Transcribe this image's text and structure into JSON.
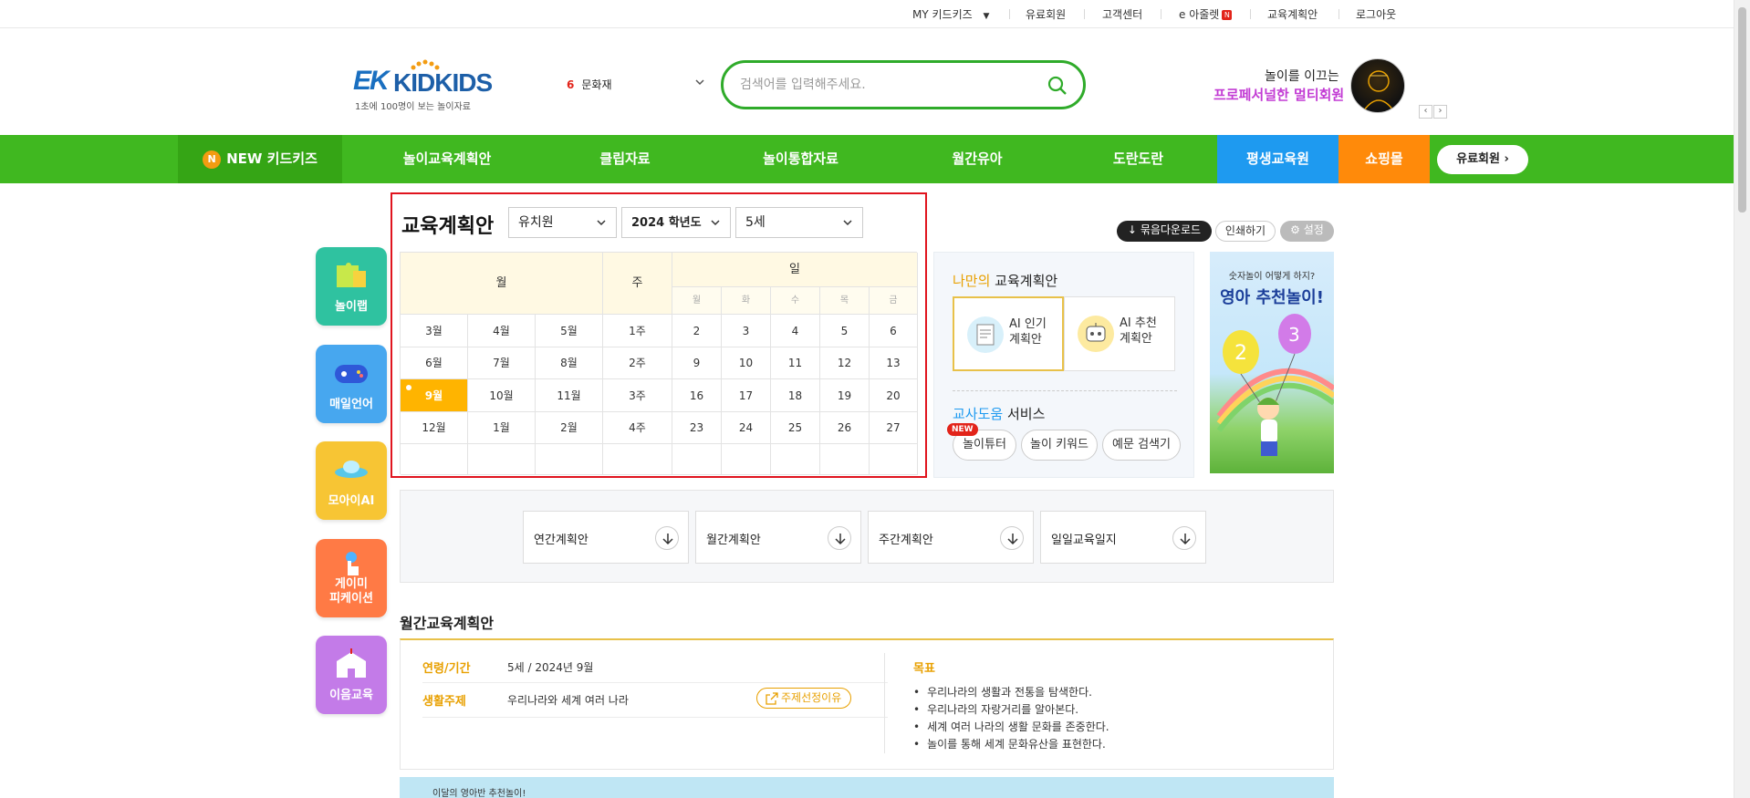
{
  "util": {
    "my_kidkids": "MY 키드키즈",
    "paid_member": "유료회원",
    "customer_center": "고객센터",
    "e_album": "e 아줄렛",
    "e_album_badge": "N",
    "edu_plan": "교육계획안",
    "logout": "로그아웃"
  },
  "logo": {
    "ek": "EK",
    "kids": "KIDKIDS",
    "tagline": "1초에 100명이 보는 놀이자료"
  },
  "rank": {
    "num": "6",
    "label": "문화재"
  },
  "search": {
    "placeholder": "검색어를 입력해주세요."
  },
  "promo": {
    "line1": "놀이를 이끄는",
    "line2": "프로페서널한 멀티회원",
    "prev": "‹",
    "next": "›"
  },
  "gnb": {
    "new_badge": "N",
    "new_label": "NEW 키드키즈",
    "items": [
      "놀이교육계획안",
      "클립자료",
      "놀이통합자료",
      "월간유아",
      "도란도란"
    ],
    "lifelong": "평생교육원",
    "shop": "쇼핑몰",
    "member_btn": "유료회원 ›"
  },
  "side": [
    "놀이랩",
    "매일언어",
    "모아이AI",
    "게이미\n피케이션",
    "이음교육"
  ],
  "plan": {
    "title": "교육계획안",
    "select_type": "유치원",
    "select_year": "2024 학년도",
    "select_age": "5세",
    "hdr_month": "월",
    "hdr_week": "주",
    "hdr_day": "일",
    "weekdays": [
      "월",
      "화",
      "수",
      "목",
      "금"
    ],
    "rows": [
      {
        "months": [
          "3월",
          "4월",
          "5월"
        ],
        "week": "1주",
        "days": [
          "2",
          "3",
          "4",
          "5",
          "6"
        ]
      },
      {
        "months": [
          "6월",
          "7월",
          "8월"
        ],
        "week": "2주",
        "days": [
          "9",
          "10",
          "11",
          "12",
          "13"
        ]
      },
      {
        "months": [
          "9월",
          "10월",
          "11월"
        ],
        "week": "3주",
        "days": [
          "16",
          "17",
          "18",
          "19",
          "20"
        ]
      },
      {
        "months": [
          "12월",
          "1월",
          "2월"
        ],
        "week": "4주",
        "days": [
          "23",
          "24",
          "25",
          "26",
          "27"
        ]
      }
    ]
  },
  "toolbar": {
    "download": "묶음다운로드",
    "print": "인쇄하기",
    "settings": "설정"
  },
  "my": {
    "title_y": "나만의",
    "title_rest": " 교육계획안",
    "ai_popular": "AI 인기\n계획안",
    "ai_recommend": "AI 추천\n계획안",
    "svc_b": "교사도움",
    "svc_rest": " 서비스",
    "new_tag": "NEW",
    "pills": [
      "놀이튜터",
      "놀이 키워드",
      "예문 검색기"
    ]
  },
  "banner": {
    "t1": "숫자놀이 어떻게 하지?",
    "t2": "영아 추천놀이!"
  },
  "downloads": [
    "연간계획안",
    "월간계획안",
    "주간계획안",
    "일일교육일지"
  ],
  "monthly": {
    "title": "월간교육계획안",
    "age_key": "연령/기간",
    "age_val": "5세 / 2024년 9월",
    "theme_key": "생활주제",
    "theme_val": "우리나라와 세계 여러 나라",
    "reason_btn": "주제선정이유",
    "goal_title": "목표",
    "goals": [
      "우리나라의 생활과 전통을 탐색한다.",
      "우리나라의 자랑거리를 알아본다.",
      "세계 여러 나라의 생활 문화를 존중한다.",
      "놀이를 통해 세계 문화유산을 표현한다."
    ]
  },
  "bottom_banner": {
    "text": "이달의 영아반 추천놀이!"
  },
  "colors": {
    "green": "#40b820",
    "blue": "#1e9af0",
    "orange": "#ff8a0a",
    "red": "#e0141e",
    "gold": "#ffb400"
  }
}
